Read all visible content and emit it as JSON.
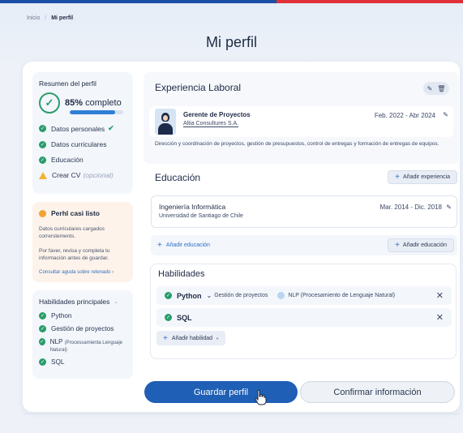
{
  "breadcrumb": {
    "home": "Inicio",
    "separator": "/",
    "current": "Mi perfil"
  },
  "page_title": "Mi perfil",
  "summary": {
    "title": "Resumen del perfil",
    "percent": "85%",
    "percent_suffix": "completo",
    "progress_fraction": 0.85,
    "items": [
      {
        "label": "Datos personales",
        "status": "done",
        "tick": "✔"
      },
      {
        "label": "Datos curriculares",
        "status": "done"
      },
      {
        "label": "Educación",
        "status": "done"
      },
      {
        "label": "Crear CV",
        "status": "warning",
        "note": "(opcional)"
      }
    ]
  },
  "almost_ready": {
    "title": "Perhl casi listo",
    "text1": "Datos curriculares cargados correrstements.",
    "text2": "Por faver, revisa y completa tu información antes de guardar.",
    "link": "Consultar aguda sobre relenado ›"
  },
  "top_skills": {
    "title": "Habilidades principales",
    "items": [
      {
        "label": "Python"
      },
      {
        "label": "Gestión de proyectos"
      },
      {
        "label": "NLP",
        "sub": "(Processamienta Lenguaje Natural)"
      },
      {
        "label": "SQL"
      }
    ]
  },
  "experience": {
    "title": "Experiencia Laboral",
    "job": {
      "title": "Gerente de Proyectos",
      "company": "Altia Consultures S.A.",
      "dates": "Feb. 2022 - Abr 2024",
      "description": "Dirección y coordinación de proyectos, gestión de presupuestos, control de entregas y formación de entregas de equipos."
    }
  },
  "education": {
    "title": "Educación",
    "add_experience": "Añadir experiencia",
    "entry": {
      "degree": "Ingeniería Informática",
      "school": "Universidad de Santiago de Chile",
      "dates": "Mar. 2014 - Dic. 2018"
    },
    "add_link": "Añadir educación",
    "add_button": "Añadir educación"
  },
  "skills": {
    "title": "Habilidades",
    "row1": {
      "main": "Python",
      "secondary": "Gestión de proyectos",
      "third": "NLP (Procesamiento de Lenguaje Natural)"
    },
    "row2": {
      "main": "SQL"
    },
    "add": "Añadir habilidad"
  },
  "actions": {
    "save": "Guardar perfil",
    "confirm": "Confirmar información"
  },
  "colors": {
    "primary": "#1f5fb5",
    "success": "#2a9d6a",
    "warning": "#f2b233",
    "accent_red": "#e0313a"
  }
}
